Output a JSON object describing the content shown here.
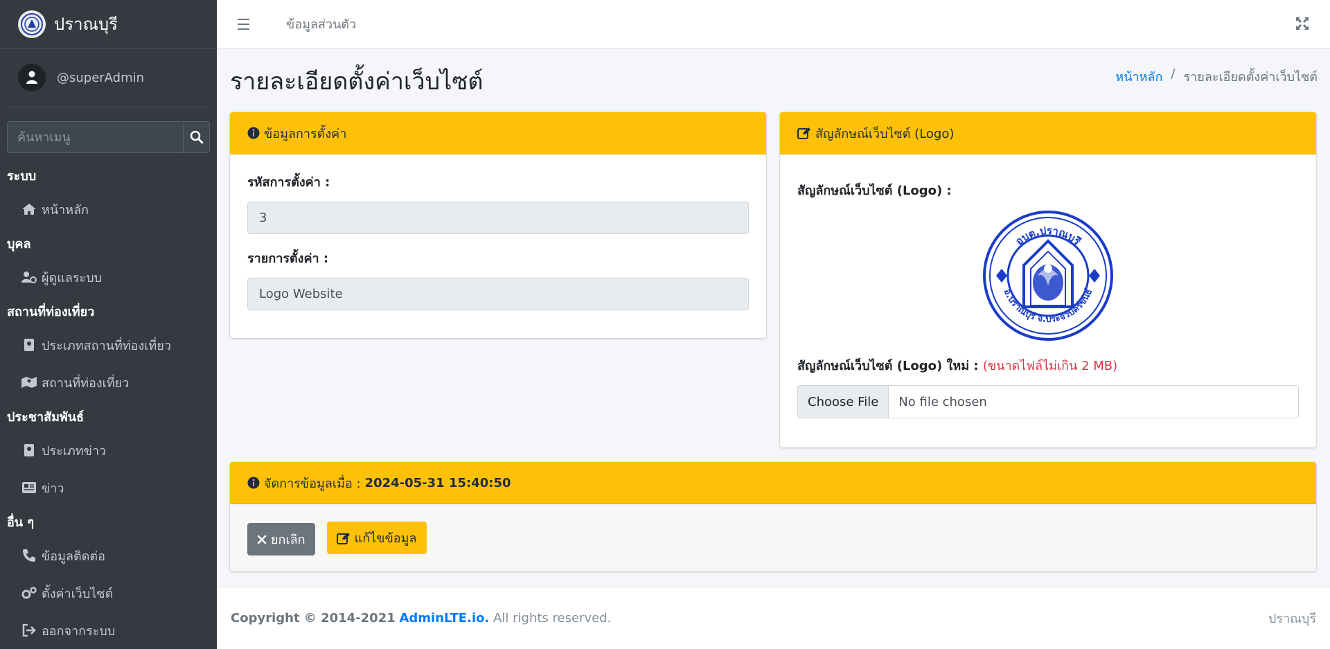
{
  "brand": {
    "name": "ปราณบุรี"
  },
  "user": {
    "name": "@superAdmin"
  },
  "search": {
    "placeholder": "ค้นหาเมนู"
  },
  "sidebar": {
    "sections": [
      {
        "header": "ระบบ",
        "items": [
          {
            "label": "หน้าหลัก",
            "icon": "home-icon"
          }
        ]
      },
      {
        "header": "บุคล",
        "items": [
          {
            "label": "ผู้ดูแลระบบ",
            "icon": "user-cog-icon"
          }
        ]
      },
      {
        "header": "สถานที่ท่องเที่ยว",
        "items": [
          {
            "label": "ประเภทสถานที่ท่องเที่ยว",
            "icon": "book-icon"
          },
          {
            "label": "สถานที่ท่องเที่ยว",
            "icon": "map-icon"
          }
        ]
      },
      {
        "header": "ประชาสัมพันธ์",
        "items": [
          {
            "label": "ประเภทข่าว",
            "icon": "book-icon"
          },
          {
            "label": "ข่าว",
            "icon": "newspaper-icon"
          }
        ]
      },
      {
        "header": "อื่น ๆ",
        "items": [
          {
            "label": "ข้อมูลติดต่อ",
            "icon": "phone-icon"
          },
          {
            "label": "ตั้งค่าเว็บไซต์",
            "icon": "cogs-icon"
          },
          {
            "label": "ออกจากระบบ",
            "icon": "sign-out-icon"
          }
        ]
      }
    ]
  },
  "topbar": {
    "link": "ข้อมูลส่วนตัว"
  },
  "page": {
    "title": "รายละเอียดตั้งค่าเว็บไซต์"
  },
  "breadcrumb": {
    "home": "หน้าหลัก",
    "separator": "/",
    "current": "รายละเอียดตั้งค่าเว็บไซต์"
  },
  "settings_card": {
    "title": "ข้อมูลการตั้งค่า",
    "code_label": "รหัสการตั้งค่า :",
    "code_value": "3",
    "item_label": "รายการตั้งค่า :",
    "item_value": "Logo Website"
  },
  "logo_card": {
    "title": "สัญลักษณ์เว็บไซต์ (Logo)",
    "current_label": "สัญลักษณ์เว็บไซต์ (Logo) :",
    "logo_top_text": "อบต.ปราณบุรี",
    "logo_bottom_text": "อ.ปราณบุรี จ.ประจวบคีรีขันธ์",
    "new_label": "สัญลักษณ์เว็บไซต์ (Logo) ใหม่ :",
    "new_hint": "(ขนาดไฟล์ไม่เกิน 2 MB)",
    "file_button": "Choose File",
    "file_status": "No file chosen"
  },
  "manage_card": {
    "label": "จัดการข้อมูลเมื่อ :",
    "timestamp": "2024-05-31 15:40:50",
    "cancel": "ยกเลิก",
    "edit": "แก้ไขข้อมูล"
  },
  "footer": {
    "copyright": "Copyright © 2014-2021",
    "link": "AdminLTE.io.",
    "rights": "All rights reserved.",
    "right_text": "ปราณบุรี"
  },
  "colors": {
    "accent": "#ffc107",
    "sidebar": "#343a40",
    "link": "#007bff",
    "danger": "#dc3545"
  }
}
